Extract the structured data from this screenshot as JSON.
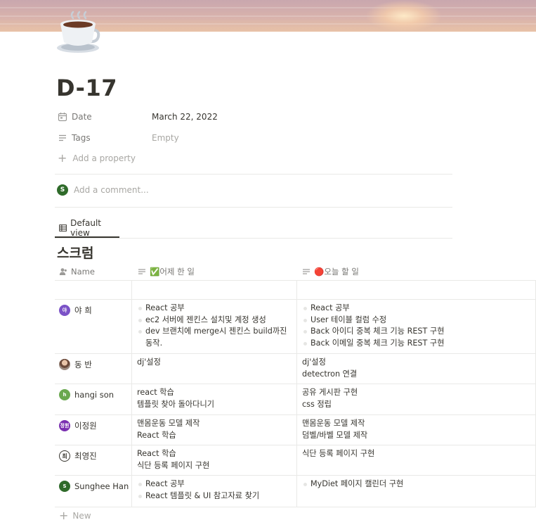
{
  "page": {
    "title": "D-17",
    "icon": "coffee-cup-icon"
  },
  "properties": {
    "date": {
      "label": "Date",
      "value": "March 22, 2022",
      "icon": "calendar-icon"
    },
    "tags": {
      "label": "Tags",
      "value": "Empty",
      "icon": "text-lines-icon"
    },
    "add_property_label": "Add a property"
  },
  "comment": {
    "avatar_letter": "S",
    "placeholder": "Add a comment..."
  },
  "view": {
    "tab_label": "Default view",
    "db_title": "스크럼"
  },
  "table": {
    "columns": [
      {
        "label": "Name",
        "icon": "person-icon"
      },
      {
        "label": "어제 한 일",
        "emoji": "✅",
        "icon": "text-lines-icon"
      },
      {
        "label": "오늘 할 일",
        "emoji": "🔴",
        "icon": "text-lines-icon"
      }
    ],
    "rows": [
      {
        "name": "",
        "avatar": "",
        "avatar_color": "",
        "yesterday": [],
        "yesterday_bullets": false,
        "today": [],
        "today_bullets": false
      },
      {
        "name": "야 희",
        "avatar": "야",
        "avatar_color": "#7b52c7",
        "yesterday": [
          "React 공부",
          "ec2 서버에 젠킨스 설치및 계정 생성",
          "dev 브랜치에 merge시 젠킨스 build까진 동작."
        ],
        "yesterday_bullets": true,
        "today": [
          "React 공부",
          "User 테이블 컬럼 수정",
          "Back 아이디 중복 체크 기능 REST 구현",
          "Back 이메일 중복 체크 기능 REST 구현"
        ],
        "today_bullets": true
      },
      {
        "name": "동 반",
        "avatar": "",
        "avatar_color": "#8a6a5a",
        "yesterday": [
          "dj'설정"
        ],
        "yesterday_bullets": false,
        "today": [
          "dj'설정",
          "detectron 연결"
        ],
        "today_bullets": false
      },
      {
        "name": "hangi son",
        "avatar": "h",
        "avatar_color": "#6aa84f",
        "yesterday": [
          "react 학습",
          "템플릿 찾아 돌아다니기"
        ],
        "yesterday_bullets": false,
        "today": [
          "공유 게시판 구현",
          "css 정립"
        ],
        "today_bullets": false
      },
      {
        "name": "이정원",
        "avatar": "정원",
        "avatar_color": "#7a2fb0",
        "yesterday": [
          "맨몸운동 모델 제작",
          "React 학습"
        ],
        "yesterday_bullets": false,
        "today": [
          "맨몸운동 모델 제작",
          "덤벨/바벨 모델 제작"
        ],
        "today_bullets": false
      },
      {
        "name": "최영진",
        "avatar": "최",
        "avatar_color": "#ffffff",
        "yesterday": [
          "React 학습",
          "식단 등록 페이지 구현"
        ],
        "yesterday_bullets": false,
        "today": [
          "식단 등록 페이지 구현"
        ],
        "today_bullets": false
      },
      {
        "name": "Sunghee Han",
        "avatar": "S",
        "avatar_color": "#2f6b2a",
        "yesterday": [
          "React 공부",
          "React 템플릿 & UI 참고자료 찾기"
        ],
        "yesterday_bullets": true,
        "today": [
          "MyDiet 페이지 캘린더 구현"
        ],
        "today_bullets": true
      }
    ],
    "new_label": "New"
  },
  "colors": {
    "text": "#37352f",
    "muted": "#787774",
    "placeholder": "#a8a7a3",
    "border": "#e9e9e7"
  }
}
